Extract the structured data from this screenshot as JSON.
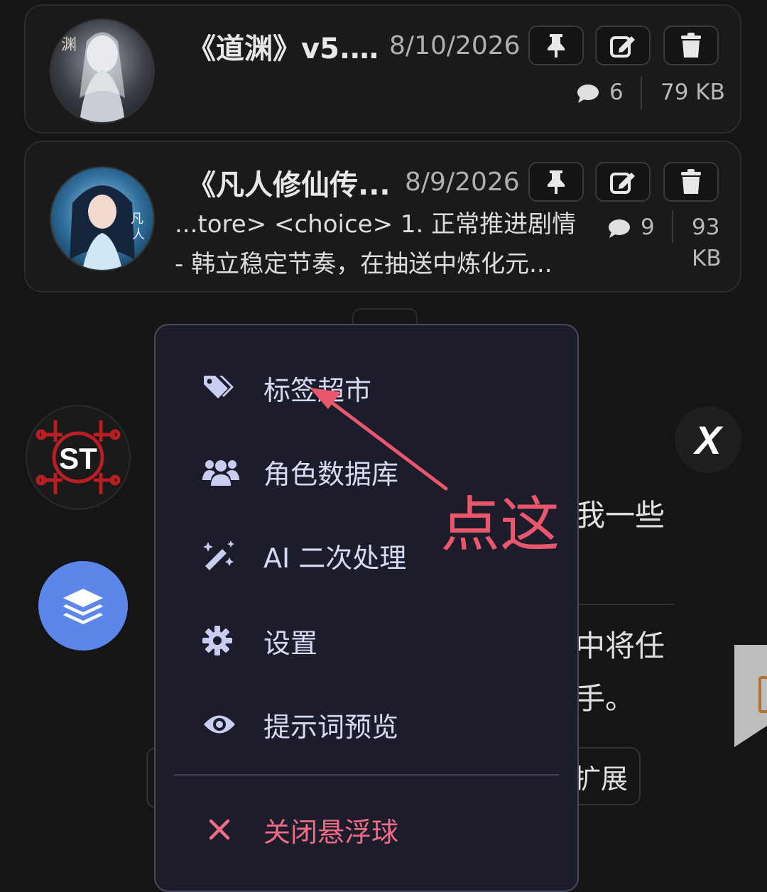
{
  "colors": {
    "background": "#151515",
    "menu_bg": "#1c1c2a",
    "menu_text": "#d7d9f2",
    "danger": "#ef6b86",
    "annotation": "#e8576c",
    "fab": "#5b87ea"
  },
  "chats": [
    {
      "title": "《道渊》v5....",
      "date": "8/10/2026",
      "messages": "6",
      "size": "79 KB",
      "excerpt_line1": "",
      "excerpt_line2": "",
      "avatar_icon": "character-portrait-white-hair"
    },
    {
      "title": "《凡人修仙传...",
      "date": "8/9/2026",
      "messages": "9",
      "size_line1": "93",
      "size_line2": "KB",
      "excerpt_line1": "...tore> <choice> 1. 正常推进剧情",
      "excerpt_line2": "- 韩立稳定节奏，在抽送中炼化元...",
      "avatar_icon": "character-portrait-blue-hair"
    }
  ],
  "background_fragments": {
    "line_a": "我一些",
    "line_b": "中将任",
    "line_c": "手。",
    "extend_button": "扩展",
    "st_logo": "ST",
    "x_logo": "X"
  },
  "menu": {
    "items": [
      {
        "label": "标签超市",
        "icon": "tags-icon"
      },
      {
        "label": "角色数据库",
        "icon": "users-icon"
      },
      {
        "label": "AI 二次处理",
        "icon": "magic-wand-icon"
      },
      {
        "label": "设置",
        "icon": "gear-icon"
      },
      {
        "label": "提示词预览",
        "icon": "eye-icon"
      }
    ],
    "close_label": "关闭悬浮球",
    "close_icon": "close-icon"
  },
  "annotation": {
    "text": "点这"
  }
}
